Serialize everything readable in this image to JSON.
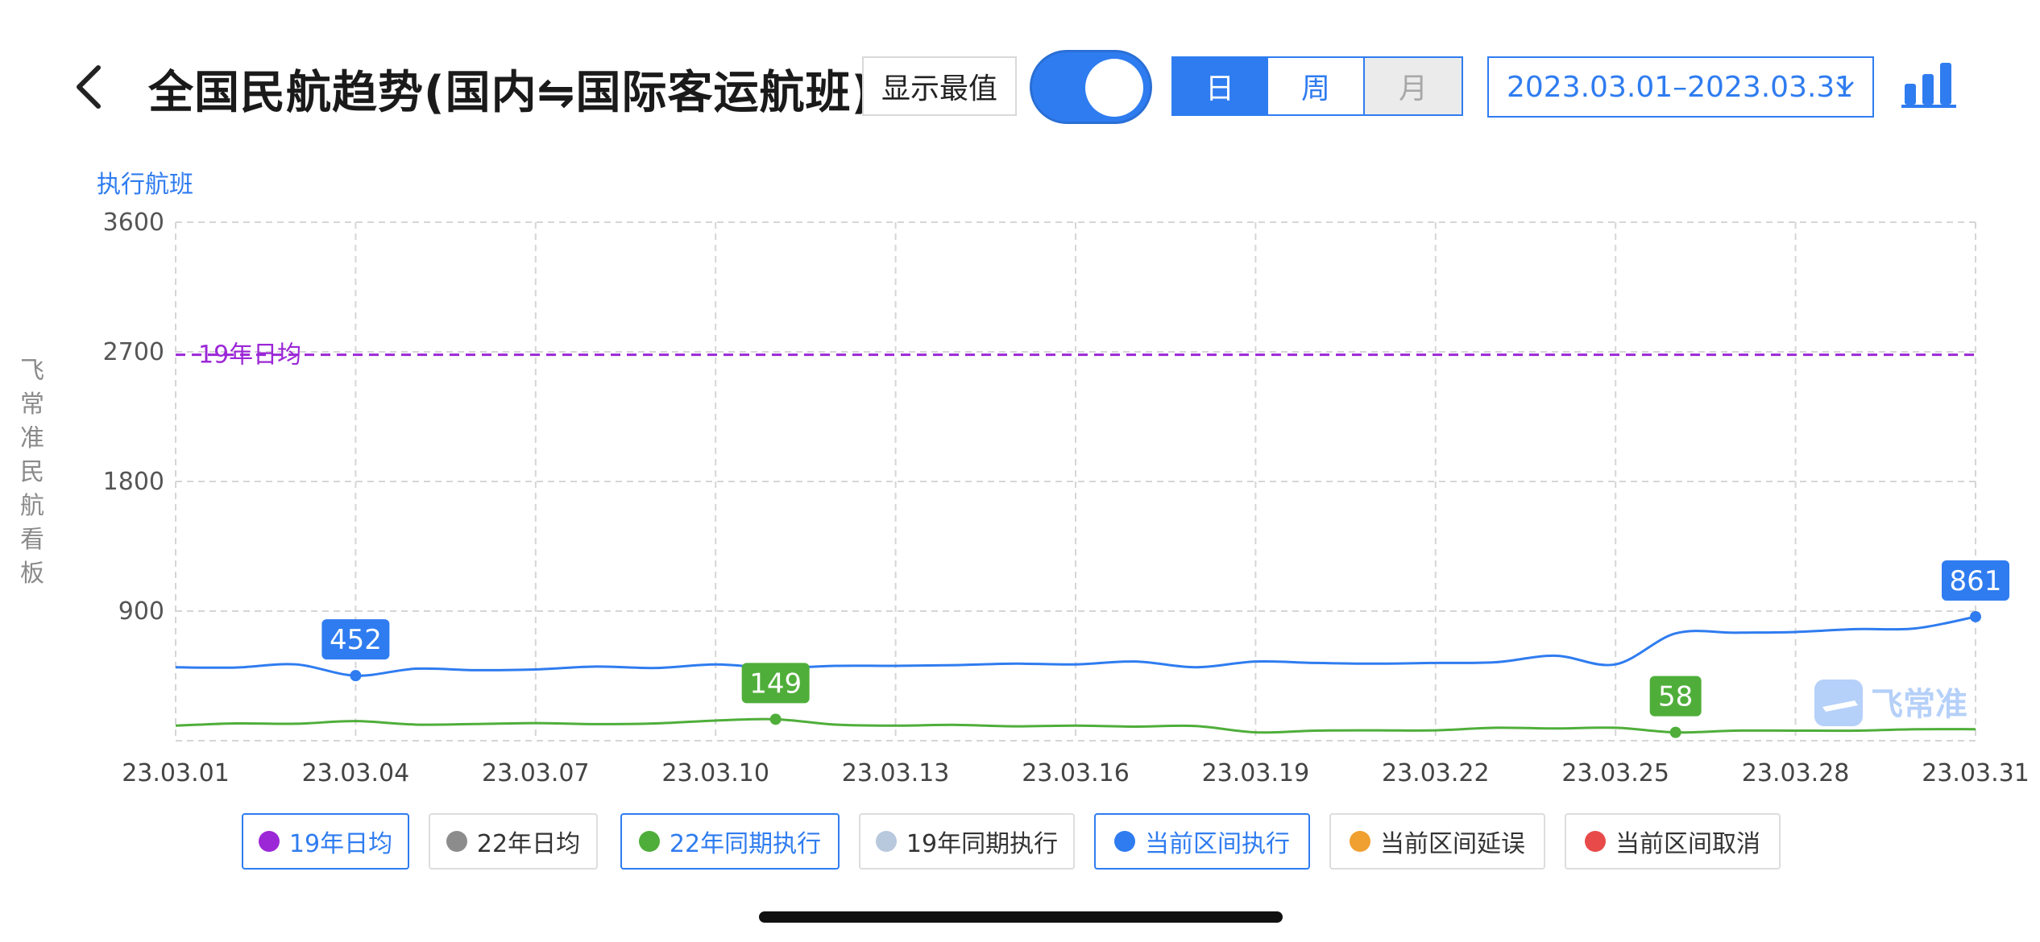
{
  "header": {
    "title": "全国民航趋势(国内⇋国际客运航班)",
    "show_max_label": "显示最值",
    "toggle_on": true,
    "segments": [
      "日",
      "周",
      "月"
    ],
    "date_range": "2023.03.01–2023.03.31"
  },
  "watermark_vertical": "飞常准民航看板",
  "brand_watermark": "飞常准",
  "colors": {
    "accent": "#2f7cf0",
    "current_exec": "#2f7cf0",
    "y22_same": "#4fae3a",
    "y19_avg": "#9b27d6",
    "y22_avg": "#8c8c8c",
    "y19_same": "#b8c8dd",
    "delay": "#f0a030",
    "cancel": "#e84a4a"
  },
  "legend": [
    {
      "label": "19年日均",
      "color": "#9b27d6",
      "active": true
    },
    {
      "label": "22年日均",
      "color": "#8c8c8c",
      "active": false
    },
    {
      "label": "22年同期执行",
      "color": "#4fae3a",
      "active": true
    },
    {
      "label": "19年同期执行",
      "color": "#b8c8dd",
      "active": false
    },
    {
      "label": "当前区间执行",
      "color": "#2f7cf0",
      "active": true
    },
    {
      "label": "当前区间延误",
      "color": "#f0a030",
      "active": false
    },
    {
      "label": "当前区间取消",
      "color": "#e84a4a",
      "active": false
    }
  ],
  "chart_data": {
    "type": "line",
    "ylabel": "执行航班",
    "ylim": [
      0,
      3600
    ],
    "y_ticks": [
      "3600",
      "2700",
      "1800",
      "900"
    ],
    "x_tick_labels": [
      "23.03.01",
      "23.03.04",
      "23.03.07",
      "23.03.10",
      "23.03.13",
      "23.03.16",
      "23.03.19",
      "23.03.22",
      "23.03.25",
      "23.03.28",
      "23.03.31"
    ],
    "x": [
      "23.03.01",
      "23.03.02",
      "23.03.03",
      "23.03.04",
      "23.03.05",
      "23.03.06",
      "23.03.07",
      "23.03.08",
      "23.03.09",
      "23.03.10",
      "23.03.11",
      "23.03.12",
      "23.03.13",
      "23.03.14",
      "23.03.15",
      "23.03.16",
      "23.03.17",
      "23.03.18",
      "23.03.19",
      "23.03.20",
      "23.03.21",
      "23.03.22",
      "23.03.23",
      "23.03.24",
      "23.03.25",
      "23.03.26",
      "23.03.27",
      "23.03.28",
      "23.03.29",
      "23.03.30",
      "23.03.31"
    ],
    "series": [
      {
        "name": "当前区间执行",
        "values": [
          510,
          508,
          530,
          452,
          500,
          490,
          495,
          515,
          505,
          530,
          505,
          520,
          520,
          525,
          535,
          530,
          550,
          510,
          550,
          540,
          535,
          540,
          545,
          590,
          530,
          745,
          750,
          755,
          775,
          780,
          861
        ]
      },
      {
        "name": "22年同期执行",
        "values": [
          105,
          120,
          118,
          136,
          112,
          116,
          122,
          115,
          120,
          140,
          149,
          112,
          105,
          110,
          100,
          105,
          98,
          102,
          58,
          70,
          72,
          72,
          90,
          85,
          90,
          58,
          70,
          70,
          70,
          80,
          80
        ]
      }
    ],
    "reference_line": {
      "name": "19年日均",
      "value": 2680
    },
    "annotations": [
      {
        "series": "当前区间执行",
        "x": "23.03.04",
        "label": "452"
      },
      {
        "series": "当前区间执行",
        "x": "23.03.31",
        "label": "861"
      },
      {
        "series": "22年同期执行",
        "x": "23.03.11",
        "label": "149"
      },
      {
        "series": "22年同期执行",
        "x": "23.03.26",
        "label": "58"
      }
    ],
    "grid": true
  }
}
